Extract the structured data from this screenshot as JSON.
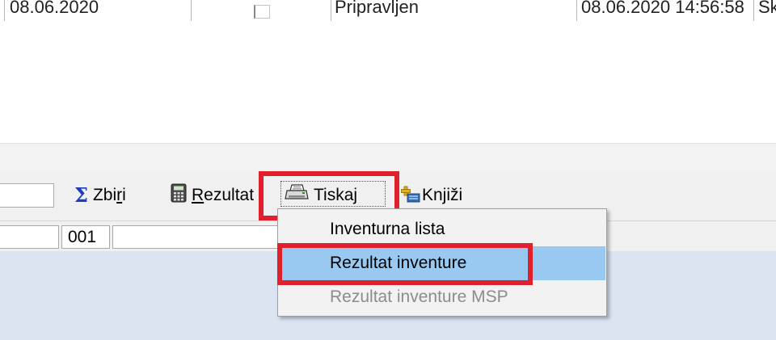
{
  "table_row": {
    "date": "08.06.2020",
    "status": "Pripravljen",
    "timestamp": "08.06.2020 14:56:58",
    "trail": "Sk"
  },
  "toolbar": {
    "sum_label_pre": "Zbi",
    "sum_label_u": "r",
    "sum_label_post": "i",
    "result_label_u": "R",
    "result_label_post": "ezultat",
    "print_label": "Tiskaj",
    "post_label": "Knjiži"
  },
  "status": {
    "code": "001"
  },
  "print_menu": {
    "items": [
      {
        "label": "Inventurna lista",
        "state": "normal"
      },
      {
        "label": "Rezultat inventure",
        "state": "highlighted"
      },
      {
        "label": "Rezultat inventure MSP",
        "state": "disabled"
      }
    ]
  },
  "colors": {
    "highlight": "#99c9f1",
    "callout": "#e0212b",
    "toolbar_bg": "#f0f0f0",
    "panel_bg": "#dbe4f1"
  }
}
